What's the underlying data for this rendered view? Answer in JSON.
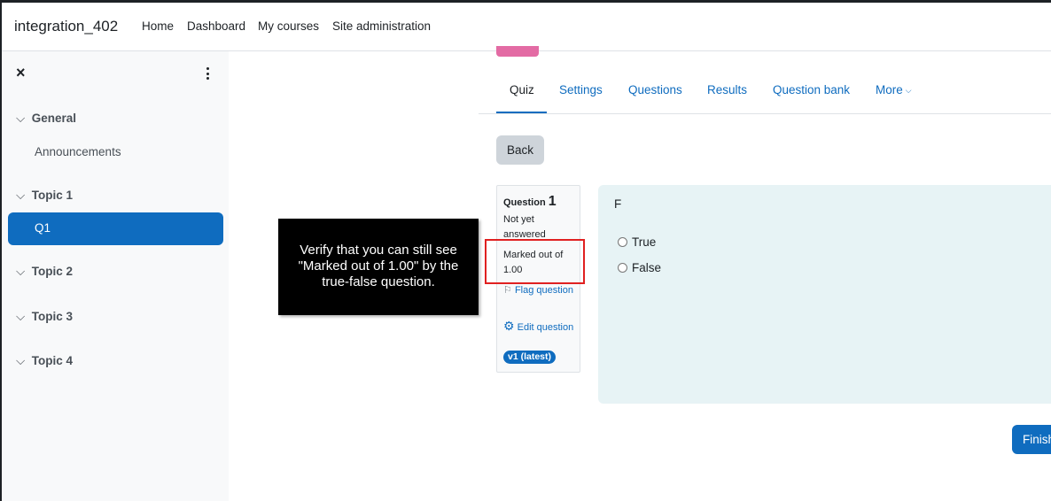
{
  "navbar": {
    "brand": "integration_402",
    "links": [
      "Home",
      "Dashboard",
      "My courses",
      "Site administration"
    ]
  },
  "drawer": {
    "close_icon": "×",
    "sections": [
      {
        "title": "General",
        "items": [
          "Announcements"
        ]
      },
      {
        "title": "Topic 1",
        "items": [
          "Q1"
        ]
      },
      {
        "title": "Topic 2",
        "items": []
      },
      {
        "title": "Topic 3",
        "items": []
      },
      {
        "title": "Topic 4",
        "items": []
      }
    ],
    "active_item": "Q1"
  },
  "tabs": {
    "items": [
      "Quiz",
      "Settings",
      "Questions",
      "Results",
      "Question bank",
      "More"
    ],
    "active": "Quiz"
  },
  "back_label": "Back",
  "question_info": {
    "label": "Question",
    "number": "1",
    "state": "Not yet answered",
    "marked": "Marked out of 1.00",
    "flag": "Flag question",
    "edit": "Edit question",
    "version": "v1 (latest)"
  },
  "question": {
    "text": "F",
    "options": [
      "True",
      "False"
    ]
  },
  "finish_label": "Finish",
  "tooltip": {
    "text": "Verify that you can still see \"Marked out of 1.00\" by the true-false question."
  },
  "colors": {
    "primary": "#0f6cbf",
    "drawer_bg": "#f8f9fa",
    "question_bg": "#e7f3f5",
    "highlight": "#e02020",
    "badge_pink": "#e36ba4"
  },
  "icons": [
    "close-icon",
    "kebab-icon",
    "chevron-down-icon",
    "flag-icon",
    "gear-icon"
  ]
}
